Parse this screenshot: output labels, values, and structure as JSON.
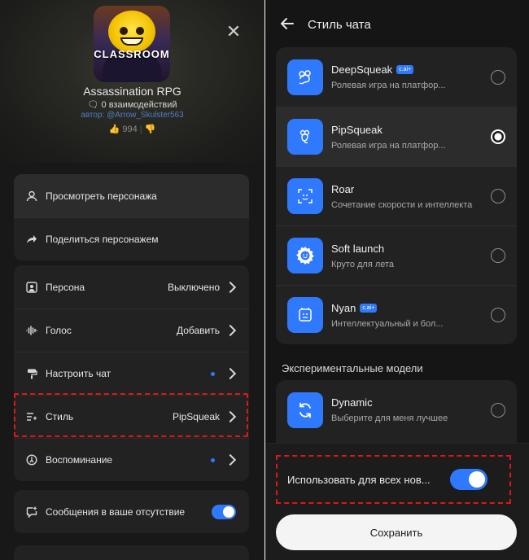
{
  "left": {
    "character": {
      "avatar_text": "CLASSROOM",
      "name": "Assassination RPG",
      "interactions": "0 взаимодействий",
      "author": "автор: @Arrow_Skulster563",
      "likes": "994"
    },
    "menu_top": [
      {
        "label": "Просмотреть персонажа"
      },
      {
        "label": "Поделиться персонажем"
      }
    ],
    "menu_settings": [
      {
        "label": "Персона",
        "value": "Выключено"
      },
      {
        "label": "Голос",
        "value": "Добавить"
      },
      {
        "label": "Настроить чат",
        "value": ""
      },
      {
        "label": "Стиль",
        "value": "PipSqueak"
      },
      {
        "label": "Воспоминание",
        "value": ""
      }
    ],
    "away_messages": {
      "label": "Сообщения в ваше отсутствие",
      "enabled": true
    }
  },
  "right": {
    "title": "Стиль чата",
    "models": [
      {
        "name": "DeepSqueak",
        "badge": "c.ai+",
        "desc": "Ролевая игра на платфор...",
        "selected": false,
        "icon": "mouse-icon"
      },
      {
        "name": "PipSqueak",
        "badge": "",
        "desc": "Ролевая игра на платфор...",
        "selected": true,
        "icon": "mouse-small-icon"
      },
      {
        "name": "Roar",
        "badge": "",
        "desc": "Сочетание скорости и интеллекта",
        "selected": false,
        "icon": "lion-icon"
      },
      {
        "name": "Soft launch",
        "badge": "",
        "desc": "Круто для лета",
        "selected": false,
        "icon": "sun-icon"
      },
      {
        "name": "Nyan",
        "badge": "c.ai+",
        "desc": "Интеллектуальный и бол...",
        "selected": false,
        "icon": "cat-icon"
      }
    ],
    "experimental_title": "Экспериментальные модели",
    "experimental": [
      {
        "name": "Dynamic",
        "desc": "Выберите для меня лучшее",
        "selected": false,
        "icon": "refresh-icon"
      }
    ],
    "use_for_all": {
      "label": "Использовать для всех нов...",
      "enabled": true
    },
    "save_label": "Сохранить"
  },
  "colors": {
    "accent": "#2f79ff",
    "highlight": "#e0161a"
  }
}
